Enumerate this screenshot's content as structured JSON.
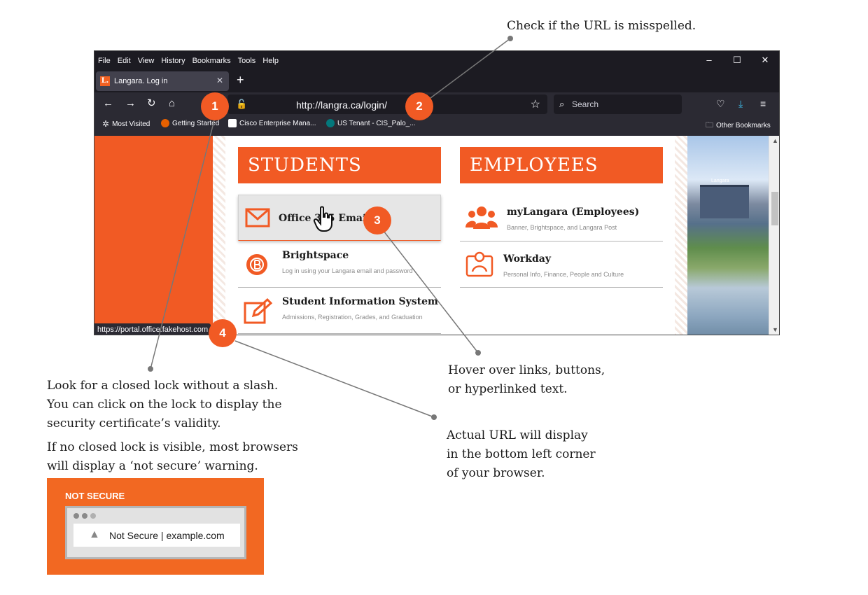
{
  "browser": {
    "menu": [
      "File",
      "Edit",
      "View",
      "History",
      "Bookmarks",
      "Tools",
      "Help"
    ],
    "tab": {
      "favicon": "L.",
      "title": "Langara. Log in"
    },
    "url": "http://langra.ca/login/",
    "search_placeholder": "Search",
    "bookmarks": [
      "Most Visited",
      "Getting Started",
      "Cisco Enterprise Mana...",
      "US Tenant - CIS_Palo_...",
      "Other Bookmarks"
    ],
    "status_url": "https://portal.office.fakehost.com"
  },
  "page": {
    "students": {
      "heading": "STUDENTS",
      "items": [
        {
          "title": "Office 365 Email",
          "sub": ""
        },
        {
          "title": "Brightspace",
          "sub": "Log in using your Langara email and password"
        },
        {
          "title": "Student Information System",
          "sub": "Admissions, Registration, Grades, and Graduation"
        }
      ]
    },
    "employees": {
      "heading": "EMPLOYEES",
      "items": [
        {
          "title": "myLangara (Employees)",
          "sub": "Banner, Brightspace, and Langara Post"
        },
        {
          "title": "Workday",
          "sub": "Personal Info, Finance, People and Culture"
        }
      ]
    },
    "campus_sign": "Langara"
  },
  "annotations": {
    "badges": [
      "1",
      "2",
      "3",
      "4"
    ],
    "note_url": "Check if the URL is misspelled.",
    "note_lock": [
      "Look for a closed lock without a slash.",
      "You can click on the lock to display the",
      "security certificate’s validity."
    ],
    "note_notsecure": [
      "If no closed lock is visible, most browsers",
      "will display a ‘not secure’ warning."
    ],
    "note_hover": [
      "Hover over links, buttons,",
      "or hyperlinked text."
    ],
    "note_actual": [
      "Actual URL will display",
      "in the bottom left corner",
      "of your browser."
    ],
    "example": {
      "title": "NOT SECURE",
      "bar": "Not Secure | example.com"
    }
  },
  "colors": {
    "accent": "#f15a24",
    "browser_dark": "#1c1b22",
    "browser_mid": "#2b2a33"
  }
}
